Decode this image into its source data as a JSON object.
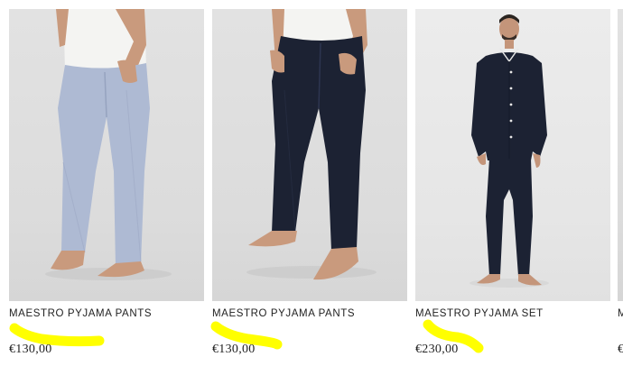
{
  "products": [
    {
      "name": "MAESTRO PYJAMA PANTS",
      "price": "€130,00",
      "image": "light-blue-pyjama-pants-photo"
    },
    {
      "name": "MAESTRO PYJAMA PANTS",
      "price": "€130,00",
      "image": "navy-pyjama-pants-photo"
    },
    {
      "name": "MAESTRO PYJAMA SET",
      "price": "€230,00",
      "image": "navy-pyjama-set-photo"
    },
    {
      "name": "M",
      "price": "€",
      "image": "partial-product-photo"
    }
  ],
  "colors": {
    "highlight": "#ffff00",
    "light_blue_fabric": "#aebad3",
    "navy_fabric": "#1c2233",
    "text": "#222222"
  }
}
